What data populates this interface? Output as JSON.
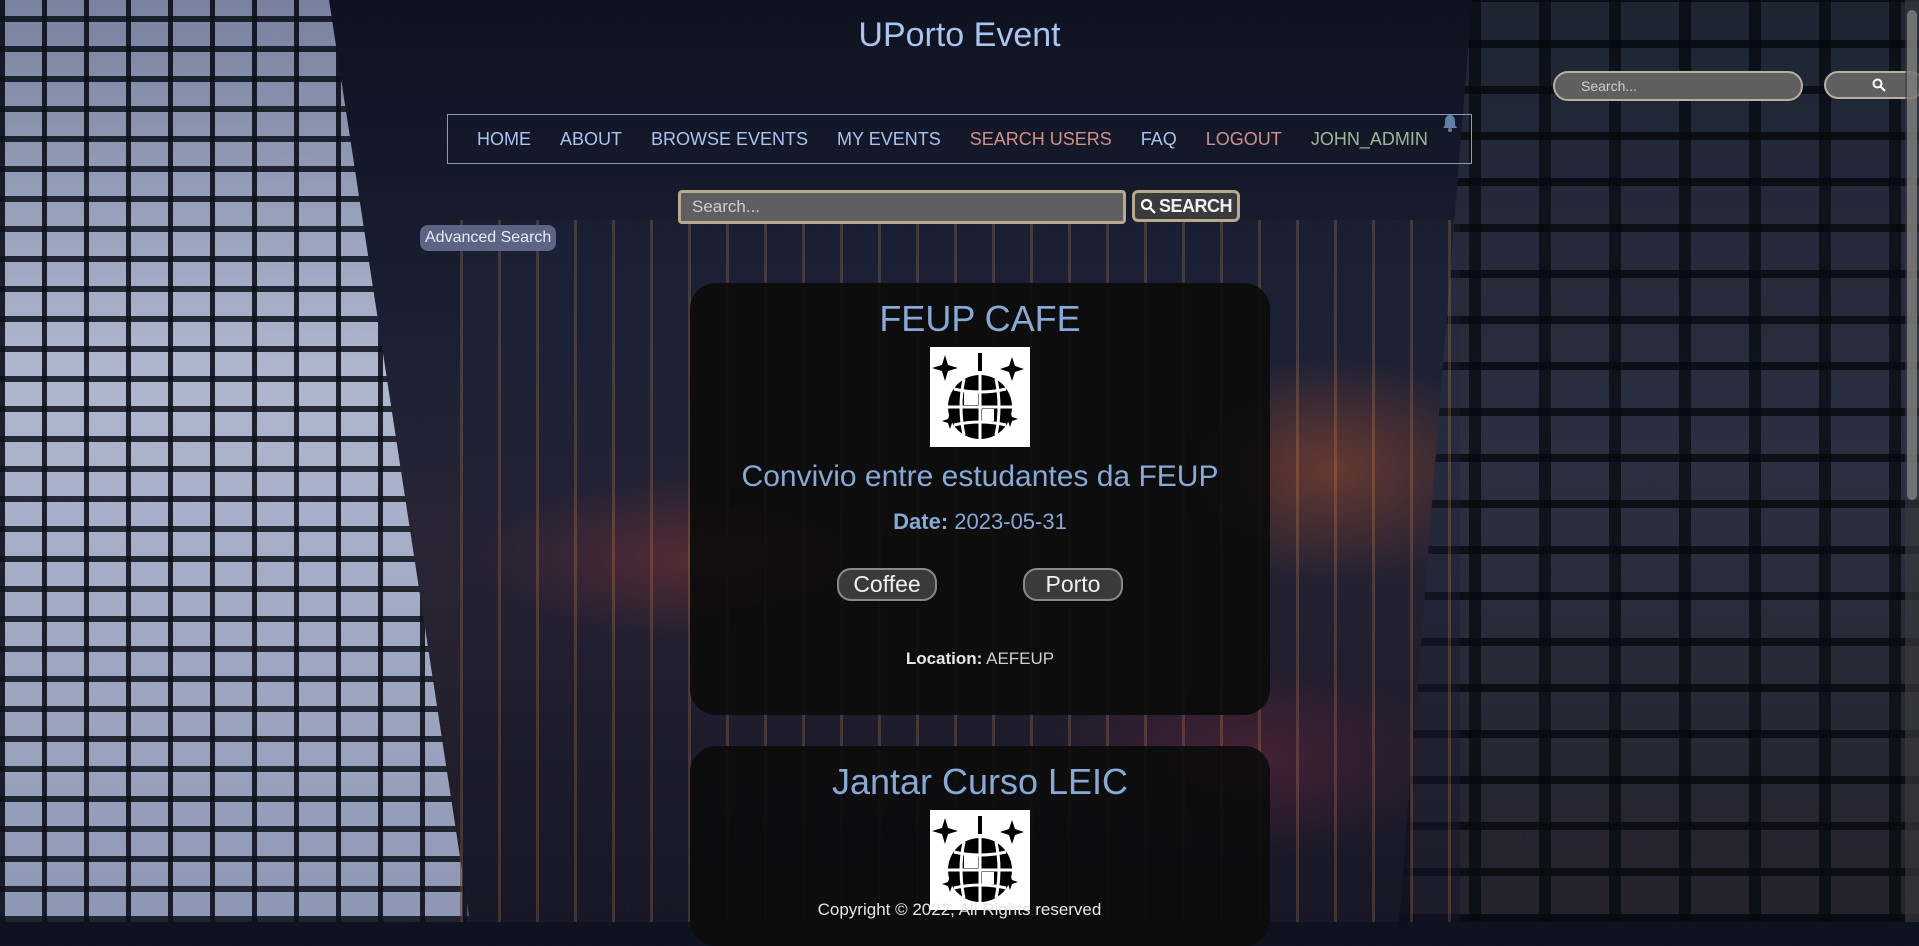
{
  "site": {
    "title": "UPorto Event",
    "footer": "Copyright © 2022, All Rights reserved"
  },
  "header_search": {
    "placeholder": "Search...",
    "button_icon": "search-icon"
  },
  "nav": {
    "items": [
      {
        "label": "HOME"
      },
      {
        "label": "ABOUT"
      },
      {
        "label": "BROWSE EVENTS"
      },
      {
        "label": "MY EVENTS"
      },
      {
        "label": "SEARCH USERS"
      },
      {
        "label": "FAQ"
      },
      {
        "label": "LOGOUT"
      },
      {
        "label": "JOHN_ADMIN"
      }
    ],
    "notification_icon": "bell-icon"
  },
  "main_search": {
    "placeholder": "Search...",
    "button_label": "SEARCH",
    "button_icon": "search-icon"
  },
  "advanced_search": {
    "label": "Advanced Search"
  },
  "events": [
    {
      "title": "FEUP CAFE",
      "image_icon": "disco-ball-icon",
      "description": "Convivio entre estudantes da FEUP",
      "date_label": "Date:",
      "date": "2023-05-31",
      "tags": [
        "Coffee",
        "Porto"
      ],
      "location_label": "Location:",
      "location": "AEFEUP"
    },
    {
      "title": "Jantar Curso LEIC",
      "image_icon": "disco-ball-icon"
    }
  ],
  "colors": {
    "accent_text": "#86a9d6",
    "nav_text": "#a9c4ef",
    "logout_text": "#d1908a",
    "user_text": "#9db896",
    "card_bg": "#0c0c0c"
  }
}
